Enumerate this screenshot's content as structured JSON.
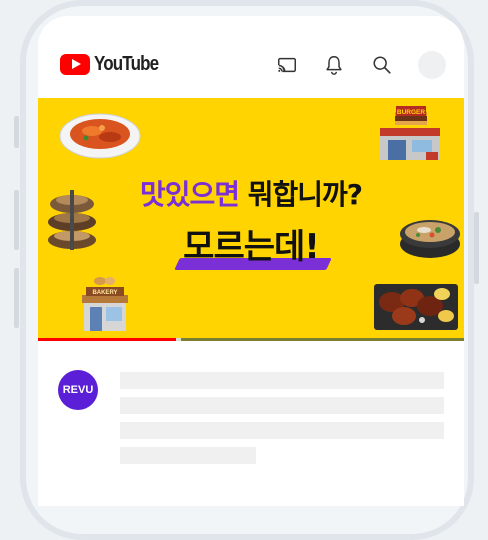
{
  "header": {
    "logo_text": "YouTube",
    "icons": [
      "cast-icon",
      "bell-icon",
      "search-icon",
      "account-avatar"
    ]
  },
  "banner": {
    "headline_part1": "맛있으면",
    "headline_part2": "뭐합니까?",
    "headline_line2": "모르는데!",
    "food_sign_burger": "BURGER",
    "food_sign_bakery": "BAKERY",
    "background_color": "#ffd400",
    "accent_color": "#7b2fd6"
  },
  "video": {
    "progress_fraction": 0.33
  },
  "channel": {
    "avatar_text": "REVU",
    "avatar_color": "#5a1fd6"
  },
  "colors": {
    "brand_red": "#ff0000"
  }
}
